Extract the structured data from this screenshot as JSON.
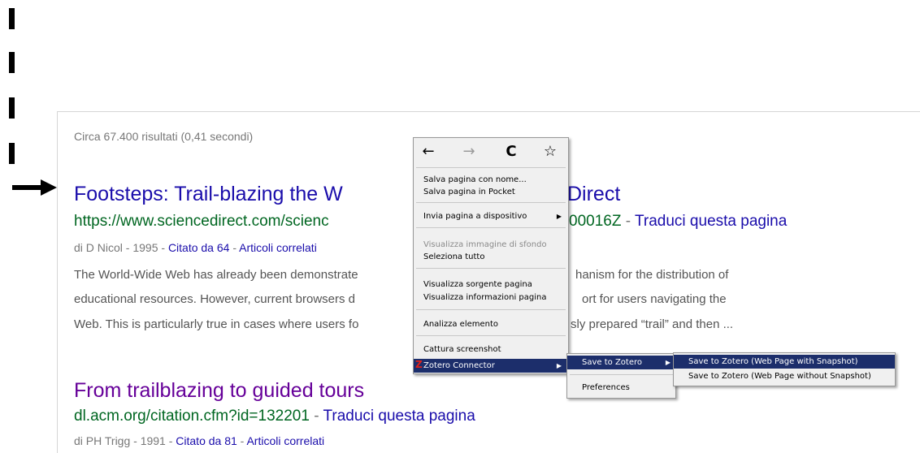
{
  "results": {
    "stats": "Circa 67.400 risultati (0,41 secondi)",
    "items": [
      {
        "title": "Footsteps: Trail-blazing the W",
        "title_tail": "Direct",
        "url": "https://www.sciencedirect.com/scienc",
        "url_tail": "00016Z",
        "url_sep": " - ",
        "translate": "Traduci questa pagina",
        "meta_author": "di D Nicol - 1995 - ",
        "meta_cited": "Citato da 64",
        "meta_sep": " - ",
        "meta_related": "Articoli correlati",
        "snippet": [
          {
            "left": "The World-Wide Web has already been demonstrate",
            "right": "hanism for the distribution of"
          },
          {
            "left": "educational resources. However, current browsers d",
            "right": "ort for users navigating the"
          },
          {
            "left": "Web. This is particularly true in cases where users fo",
            "right": "sly prepared “trail” and then ..."
          }
        ]
      },
      {
        "title": "From trailblazing to guided tours",
        "url": "dl.acm.org/citation.cfm?id=132201",
        "url_sep": " - ",
        "translate": "Traduci questa pagina",
        "meta_author": "di PH Trigg - 1991 - ",
        "meta_cited": "Citato da 81",
        "meta_sep": " - ",
        "meta_related": "Articoli correlati"
      }
    ]
  },
  "context_menu": {
    "nav": {
      "back": "←",
      "forward": "→",
      "reload": "C",
      "bookmark": "☆"
    },
    "items": [
      {
        "label": "Salva pagina con nome..."
      },
      {
        "label": "Salva pagina in Pocket"
      },
      {
        "label": "Invia pagina a dispositivo",
        "submenu": "▶"
      },
      {
        "label": "Visualizza immagine di sfondo",
        "disabled": true
      },
      {
        "label": "Seleziona tutto"
      },
      {
        "label": "Visualizza sorgente pagina"
      },
      {
        "label": "Visualizza informazioni pagina"
      },
      {
        "label": "Analizza elemento"
      },
      {
        "label": "Cattura screenshot"
      },
      {
        "label": "Zotero Connector",
        "submenu": "▶",
        "icon": "Z"
      }
    ]
  },
  "zotero_submenu": {
    "items": [
      {
        "label": "Save to Zotero",
        "submenu": "▶"
      },
      {
        "label": "Preferences"
      }
    ]
  },
  "save_submenu": {
    "items": [
      {
        "label": "Save to Zotero (Web Page with Snapshot)"
      },
      {
        "label": "Save to Zotero (Web Page without Snapshot)"
      }
    ]
  },
  "colors": {
    "link": "#1a0dab",
    "visited": "#660099",
    "url": "#006621",
    "highlight": "#1c2e6b"
  }
}
